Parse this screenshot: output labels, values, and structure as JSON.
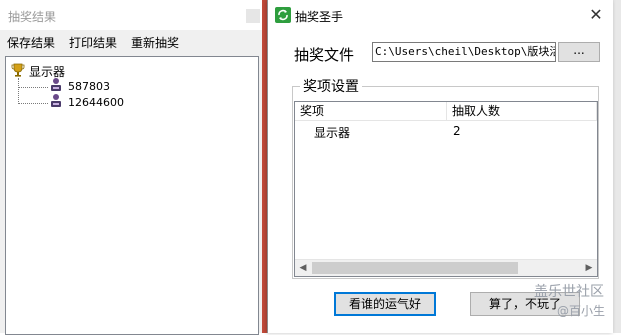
{
  "results_window": {
    "title": "抽奖结果",
    "menu": [
      "保存结果",
      "打印结果",
      "重新抽奖"
    ],
    "tree": {
      "root": "显示器",
      "children": [
        "587803",
        "12644600"
      ]
    }
  },
  "dialog": {
    "title": "抽奖圣手",
    "close_glyph": "✕",
    "file_label": "抽奖文件",
    "file_path": "C:\\Users\\cheil\\Desktop\\版块活",
    "browse_label": "...",
    "group_label": "奖项设置",
    "columns": [
      "奖项",
      "抽取人数"
    ],
    "rows": [
      {
        "prize": "显示器",
        "count": "2"
      }
    ],
    "scroll_left": "◀",
    "scroll_right": "▶",
    "button_lucky": "看谁的运气好",
    "button_quit": "算了，不玩了"
  },
  "watermark": {
    "main": "盖乐世社区",
    "sub": "@百小生"
  },
  "colors": {
    "accent_focus": "#0078d7",
    "trophy": "#d4a017",
    "app_icon": "#2e9e3e"
  }
}
